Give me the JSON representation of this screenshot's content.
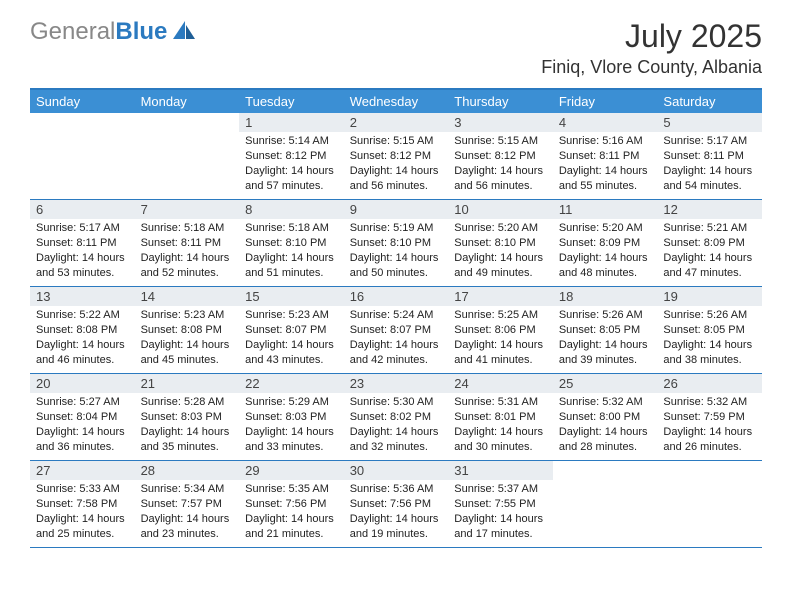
{
  "logo": {
    "part1": "General",
    "part2": "Blue"
  },
  "title": "July 2025",
  "location": "Finiq, Vlore County, Albania",
  "dow": [
    "Sunday",
    "Monday",
    "Tuesday",
    "Wednesday",
    "Thursday",
    "Friday",
    "Saturday"
  ],
  "weeks": [
    [
      null,
      null,
      {
        "n": "1",
        "sr": "5:14 AM",
        "ss": "8:12 PM",
        "dl": "14 hours and 57 minutes."
      },
      {
        "n": "2",
        "sr": "5:15 AM",
        "ss": "8:12 PM",
        "dl": "14 hours and 56 minutes."
      },
      {
        "n": "3",
        "sr": "5:15 AM",
        "ss": "8:12 PM",
        "dl": "14 hours and 56 minutes."
      },
      {
        "n": "4",
        "sr": "5:16 AM",
        "ss": "8:11 PM",
        "dl": "14 hours and 55 minutes."
      },
      {
        "n": "5",
        "sr": "5:17 AM",
        "ss": "8:11 PM",
        "dl": "14 hours and 54 minutes."
      }
    ],
    [
      {
        "n": "6",
        "sr": "5:17 AM",
        "ss": "8:11 PM",
        "dl": "14 hours and 53 minutes."
      },
      {
        "n": "7",
        "sr": "5:18 AM",
        "ss": "8:11 PM",
        "dl": "14 hours and 52 minutes."
      },
      {
        "n": "8",
        "sr": "5:18 AM",
        "ss": "8:10 PM",
        "dl": "14 hours and 51 minutes."
      },
      {
        "n": "9",
        "sr": "5:19 AM",
        "ss": "8:10 PM",
        "dl": "14 hours and 50 minutes."
      },
      {
        "n": "10",
        "sr": "5:20 AM",
        "ss": "8:10 PM",
        "dl": "14 hours and 49 minutes."
      },
      {
        "n": "11",
        "sr": "5:20 AM",
        "ss": "8:09 PM",
        "dl": "14 hours and 48 minutes."
      },
      {
        "n": "12",
        "sr": "5:21 AM",
        "ss": "8:09 PM",
        "dl": "14 hours and 47 minutes."
      }
    ],
    [
      {
        "n": "13",
        "sr": "5:22 AM",
        "ss": "8:08 PM",
        "dl": "14 hours and 46 minutes."
      },
      {
        "n": "14",
        "sr": "5:23 AM",
        "ss": "8:08 PM",
        "dl": "14 hours and 45 minutes."
      },
      {
        "n": "15",
        "sr": "5:23 AM",
        "ss": "8:07 PM",
        "dl": "14 hours and 43 minutes."
      },
      {
        "n": "16",
        "sr": "5:24 AM",
        "ss": "8:07 PM",
        "dl": "14 hours and 42 minutes."
      },
      {
        "n": "17",
        "sr": "5:25 AM",
        "ss": "8:06 PM",
        "dl": "14 hours and 41 minutes."
      },
      {
        "n": "18",
        "sr": "5:26 AM",
        "ss": "8:05 PM",
        "dl": "14 hours and 39 minutes."
      },
      {
        "n": "19",
        "sr": "5:26 AM",
        "ss": "8:05 PM",
        "dl": "14 hours and 38 minutes."
      }
    ],
    [
      {
        "n": "20",
        "sr": "5:27 AM",
        "ss": "8:04 PM",
        "dl": "14 hours and 36 minutes."
      },
      {
        "n": "21",
        "sr": "5:28 AM",
        "ss": "8:03 PM",
        "dl": "14 hours and 35 minutes."
      },
      {
        "n": "22",
        "sr": "5:29 AM",
        "ss": "8:03 PM",
        "dl": "14 hours and 33 minutes."
      },
      {
        "n": "23",
        "sr": "5:30 AM",
        "ss": "8:02 PM",
        "dl": "14 hours and 32 minutes."
      },
      {
        "n": "24",
        "sr": "5:31 AM",
        "ss": "8:01 PM",
        "dl": "14 hours and 30 minutes."
      },
      {
        "n": "25",
        "sr": "5:32 AM",
        "ss": "8:00 PM",
        "dl": "14 hours and 28 minutes."
      },
      {
        "n": "26",
        "sr": "5:32 AM",
        "ss": "7:59 PM",
        "dl": "14 hours and 26 minutes."
      }
    ],
    [
      {
        "n": "27",
        "sr": "5:33 AM",
        "ss": "7:58 PM",
        "dl": "14 hours and 25 minutes."
      },
      {
        "n": "28",
        "sr": "5:34 AM",
        "ss": "7:57 PM",
        "dl": "14 hours and 23 minutes."
      },
      {
        "n": "29",
        "sr": "5:35 AM",
        "ss": "7:56 PM",
        "dl": "14 hours and 21 minutes."
      },
      {
        "n": "30",
        "sr": "5:36 AM",
        "ss": "7:56 PM",
        "dl": "14 hours and 19 minutes."
      },
      {
        "n": "31",
        "sr": "5:37 AM",
        "ss": "7:55 PM",
        "dl": "14 hours and 17 minutes."
      },
      null,
      null
    ]
  ],
  "labels": {
    "sunrise": "Sunrise: ",
    "sunset": "Sunset: ",
    "daylight": "Daylight: "
  }
}
